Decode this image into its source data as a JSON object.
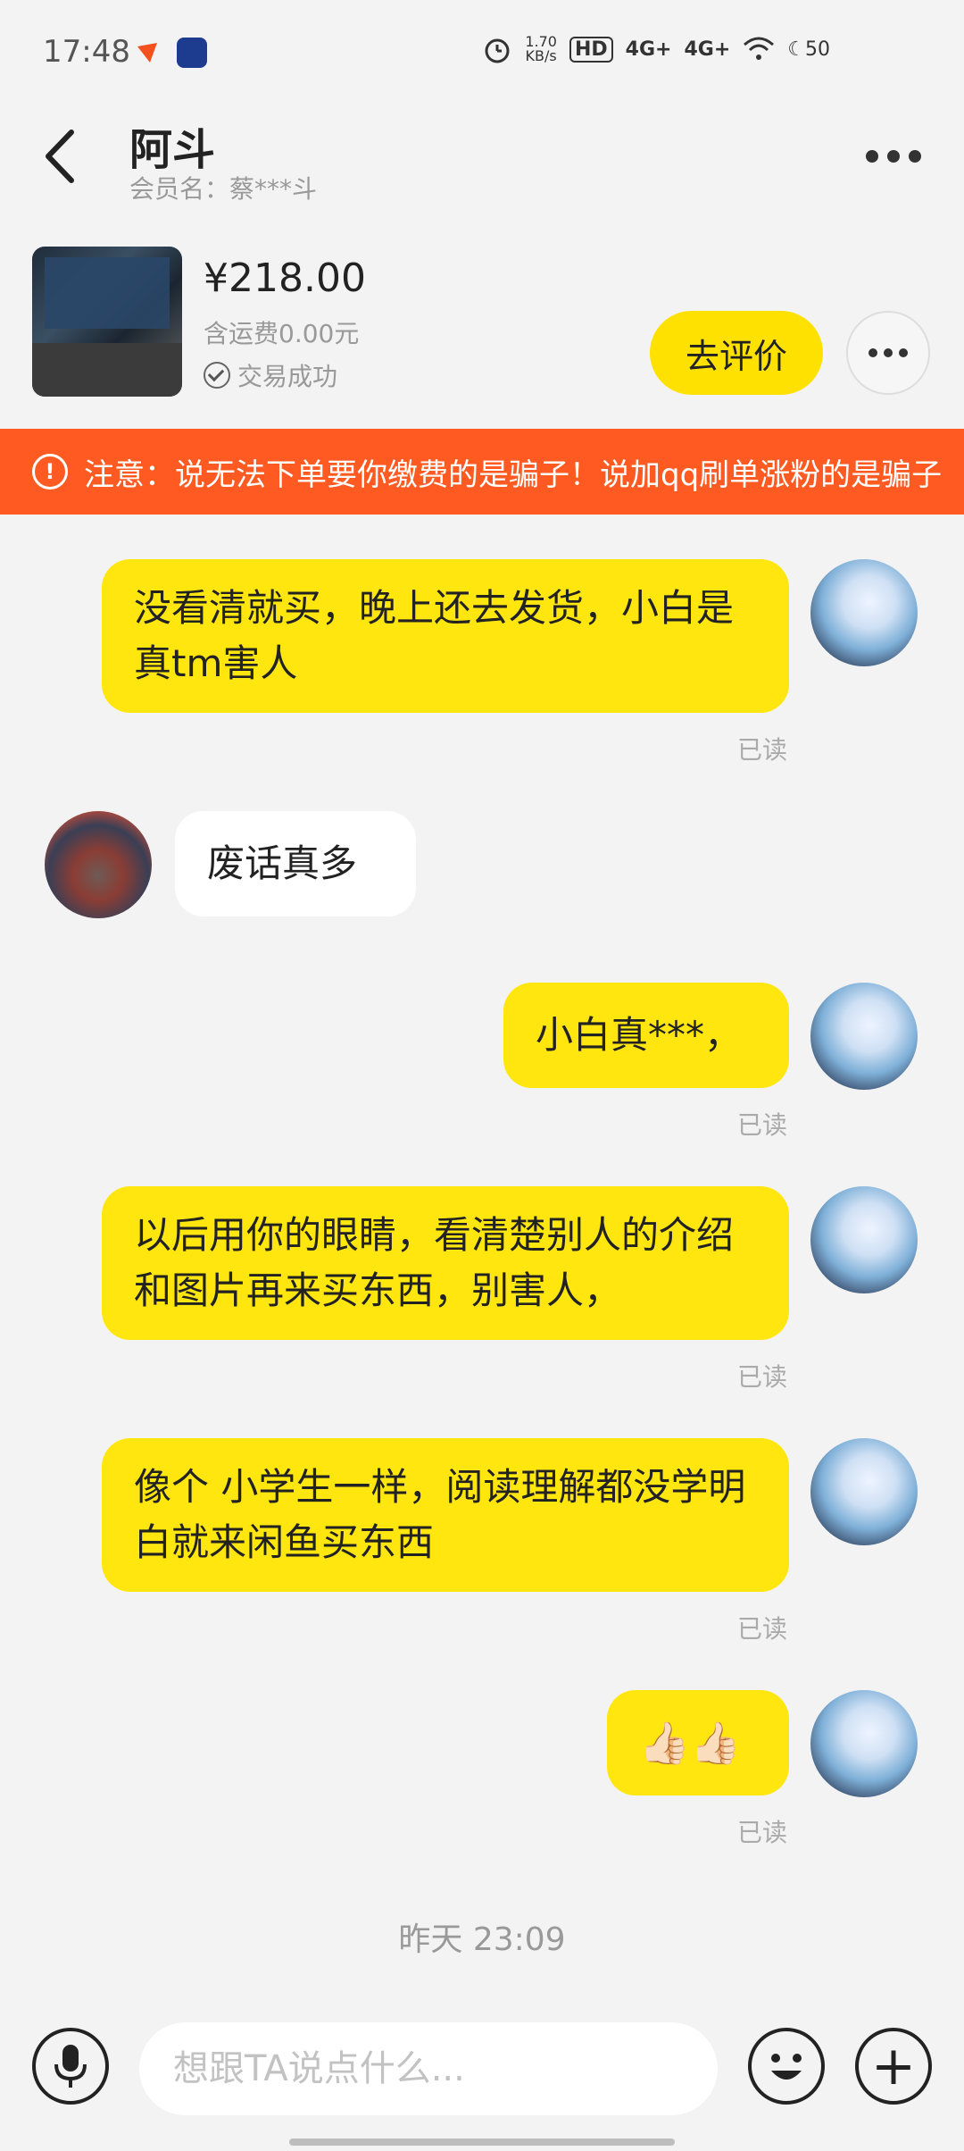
{
  "status_bar": {
    "time": "17:48",
    "net_speed_value": "1.70",
    "net_speed_unit": "KB/s",
    "hd_label": "HD",
    "signal1": "4G+",
    "signal2": "4G+",
    "battery": "50",
    "icons": [
      "alarm-icon",
      "wifi-icon",
      "moon-icon"
    ]
  },
  "header": {
    "title": "阿斗",
    "member_name": "会员名：蔡***斗"
  },
  "product": {
    "price": "¥218.00",
    "shipping": "含运费0.00元",
    "status": "交易成功",
    "review_button": "去评价"
  },
  "warning": {
    "text": "注意：说无法下单要你缴费的是骗子！说加qq刷单涨粉的是骗子"
  },
  "messages": [
    {
      "sender": "me",
      "text": "没看清就买，晚上还去发货，小白是真tm害人",
      "read": "已读"
    },
    {
      "sender": "them",
      "text": "废话真多"
    },
    {
      "sender": "me",
      "text": "小白真***，",
      "read": "已读"
    },
    {
      "sender": "me",
      "text": "以后用你的眼睛，看清楚别人的介绍和图片再来买东西，别害人，",
      "read": "已读"
    },
    {
      "sender": "me",
      "text": "像个 小学生一样，阅读理解都没学明白就来闲鱼买东西",
      "read": "已读"
    },
    {
      "sender": "me",
      "text": "👍🏻👍🏻",
      "read": "已读"
    }
  ],
  "timestamp": "昨天 23:09",
  "input": {
    "placeholder": "想跟TA说点什么..."
  },
  "colors": {
    "accent": "#ffe60f",
    "warning_bg": "#ff5a22",
    "background": "#f3f3f3"
  }
}
